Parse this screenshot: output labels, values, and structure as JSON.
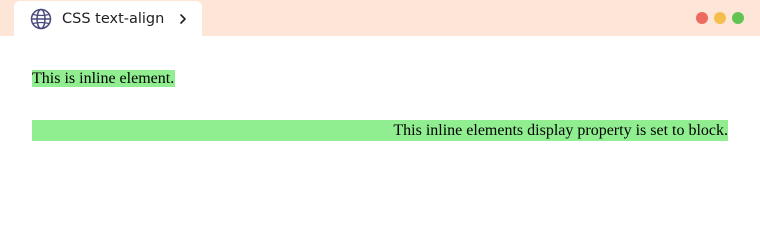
{
  "tab": {
    "title": "CSS text-align",
    "icon": "globe-icon",
    "chevron_icon": "chevron-right-icon"
  },
  "window_controls": [
    {
      "name": "close",
      "color": "#ee6a5f"
    },
    {
      "name": "minimize",
      "color": "#f5be4f"
    },
    {
      "name": "maximize",
      "color": "#61c454"
    }
  ],
  "colors": {
    "titlebar_bg": "#fde6d8",
    "highlight": "#90ee90"
  },
  "content": {
    "inline_text": "This is inline element.",
    "block_text": "This inline elements display property is set to block."
  }
}
